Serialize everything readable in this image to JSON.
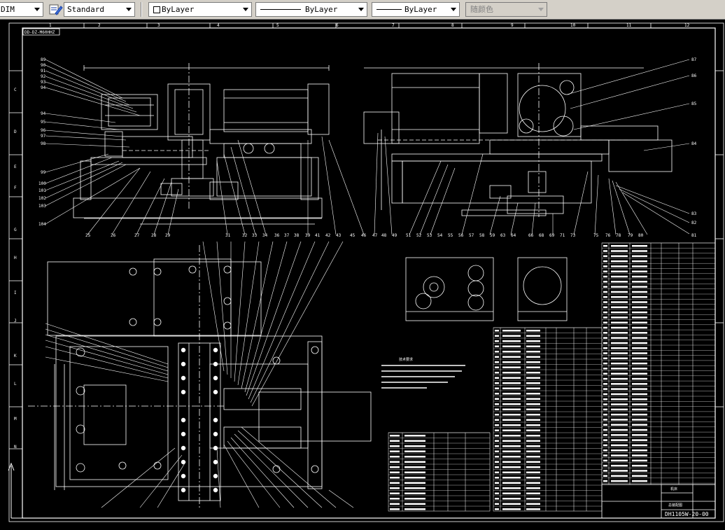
{
  "toolbar": {
    "dim_style": "DIM",
    "text_style": "Standard",
    "layer": "ByLayer",
    "linetype": "ByLayer",
    "lineweight": "ByLayer",
    "color": "随颜色"
  },
  "drawing": {
    "corner_code": "DD-DZ-M60HHZ",
    "sheet_code": "DH1105W-20-00",
    "notes_title": "技术要求",
    "row_letters": [
      "C",
      "D",
      "E",
      "F",
      "G",
      "H",
      "I",
      "J",
      "K",
      "L",
      "M",
      "N"
    ],
    "col_numbers": [
      "1",
      "2",
      "3",
      "4",
      "5",
      "6",
      "7",
      "8",
      "9",
      "10",
      "11",
      "12"
    ],
    "title_block": [
      "机床",
      "总装配图"
    ]
  }
}
